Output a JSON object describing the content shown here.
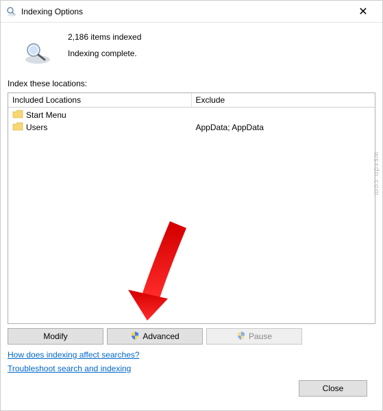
{
  "titlebar": {
    "title": "Indexing Options"
  },
  "status": {
    "count_text": "2,186 items indexed",
    "status_text": "Indexing complete."
  },
  "section_label": "Index these locations:",
  "columns": {
    "included": "Included Locations",
    "exclude": "Exclude"
  },
  "locations": [
    {
      "name": "Start Menu",
      "exclude": ""
    },
    {
      "name": "Users",
      "exclude": "AppData; AppData"
    }
  ],
  "buttons": {
    "modify": "Modify",
    "advanced": "Advanced",
    "pause": "Pause",
    "close": "Close"
  },
  "links": {
    "how": "How does indexing affect searches?",
    "troubleshoot": "Troubleshoot search and indexing"
  },
  "watermark": "wsxdn.com"
}
